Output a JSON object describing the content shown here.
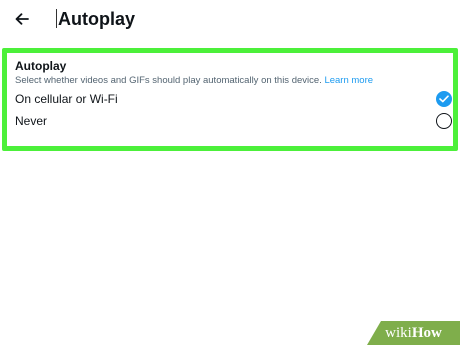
{
  "header": {
    "back_icon": "arrow-left-icon",
    "title": "Autoplay"
  },
  "section": {
    "title": "Autoplay",
    "description": "Select whether videos and GIFs should play automatically on this device.",
    "learn_more": "Learn more",
    "options": [
      {
        "label": "On cellular or Wi-Fi",
        "selected": true
      },
      {
        "label": "Never",
        "selected": false
      }
    ]
  },
  "colors": {
    "accent": "#1d9bf0",
    "highlight": "#4cf03a",
    "text": "#0f1419",
    "secondary_text": "#536471",
    "watermark_bg": "#7fae4b"
  },
  "watermark": {
    "wiki": "wiki",
    "how": "How"
  }
}
